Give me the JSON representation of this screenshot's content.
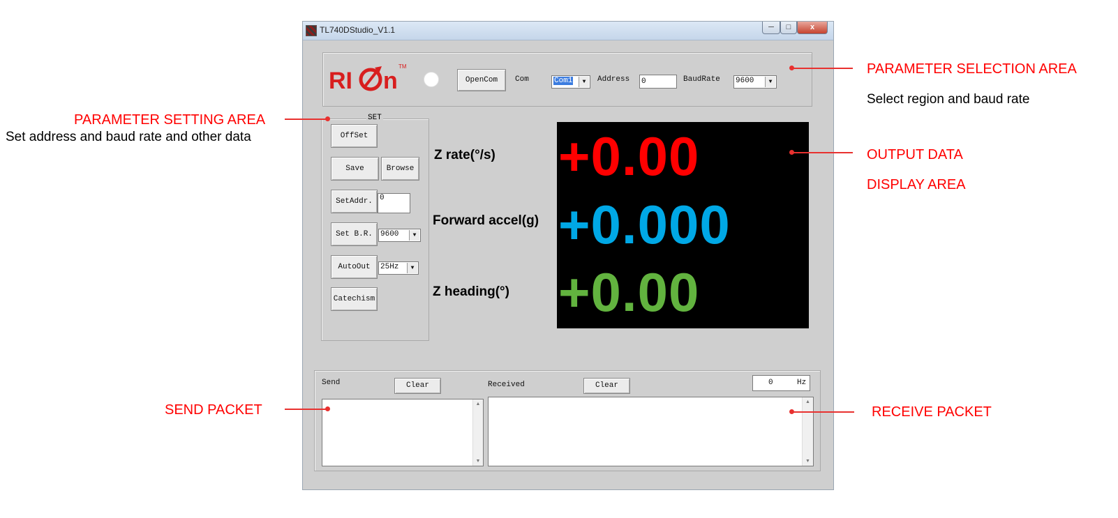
{
  "window": {
    "title": "TL740DStudio_V1.1",
    "close_label": "x"
  },
  "param_area": {
    "logo_text": "RION",
    "logo_tm": "TM",
    "open_button": "OpenCom",
    "com_label": "Com",
    "com_value": "Com1",
    "address_label": "Address",
    "address_value": "0",
    "baud_label": "BaudRate",
    "baud_value": "9600"
  },
  "set_area": {
    "group_label": "SET",
    "offset_button": "OffSet",
    "save_button": "Save",
    "browse_button": "Browse",
    "setaddr_button": "SetAddr.",
    "setaddr_value": "0",
    "setbr_button": "Set B.R.",
    "setbr_value": "9600",
    "autoout_button": "AutoOut",
    "autoout_value": "25Hz",
    "catechism_button": "Catechism"
  },
  "output": {
    "rows": [
      {
        "label": "Z rate(°/s)",
        "value": "+0.00",
        "color": "#ff0000"
      },
      {
        "label": "Forward accel(g)",
        "value": "+0.000",
        "color": "#00a8e6"
      },
      {
        "label": "Z heading(°)",
        "value": "+0.00",
        "color": "#62b33f"
      }
    ]
  },
  "packets": {
    "send_label": "Send",
    "send_clear": "Clear",
    "received_label": "Received",
    "received_clear": "Clear",
    "rate_value": "0",
    "rate_unit": "Hz"
  },
  "annotations": {
    "param_selection": "PARAMETER SELECTION AREA",
    "param_selection_desc": "Select region and baud rate",
    "param_setting": "PARAMETER SETTING AREA",
    "param_setting_desc": "Set address and baud rate and other data",
    "output_1": "OUTPUT DATA",
    "output_2": "DISPLAY AREA",
    "send_packet": "SEND PACKET",
    "receive_packet": "RECEIVE PACKET"
  },
  "colors": {
    "annotation": "#ff0000",
    "zrate": "#ff0000",
    "accel": "#00a8e6",
    "heading": "#62b33f",
    "brand": "#d81e1e"
  }
}
